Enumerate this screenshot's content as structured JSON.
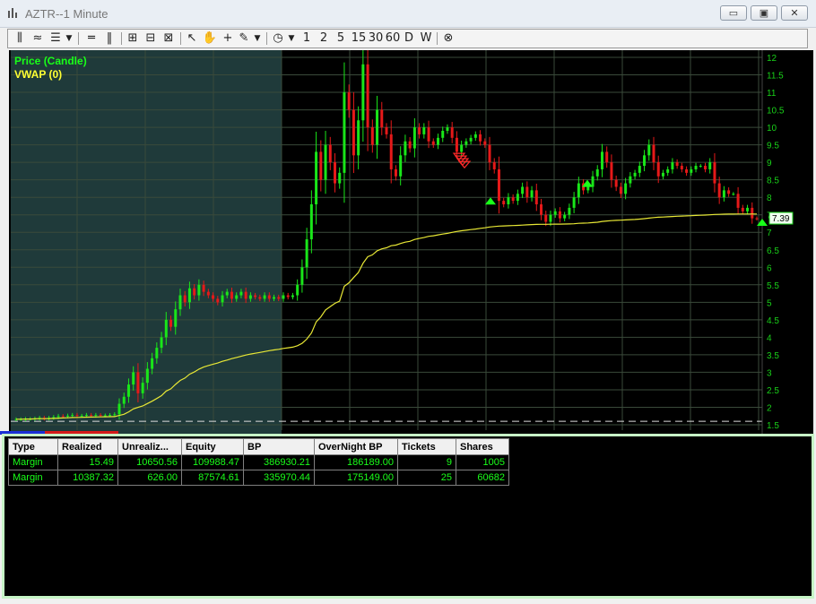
{
  "window": {
    "title": "AZTR--1 Minute",
    "controls": [
      "minimize",
      "maximize",
      "close"
    ]
  },
  "toolbar": {
    "icons": [
      "chart-type-icon",
      "drawing-style-icon",
      "indicator-list-icon",
      "dropdown-icon",
      "horizontal-line-icon",
      "vertical-line-icon",
      "zoom-in-icon",
      "zoom-out-icon",
      "fit-icon",
      "pointer-icon",
      "hand-icon",
      "crosshair-icon",
      "pencil-icon",
      "dropdown-icon",
      "clock-icon",
      "dropdown-icon"
    ],
    "intervals": [
      "1",
      "2",
      "5",
      "15",
      "30",
      "60",
      "D",
      "W"
    ],
    "close_icon": "circle-x-icon"
  },
  "chart": {
    "legend": [
      {
        "label": "Price (Candle)",
        "color": "#19ff19"
      },
      {
        "label": "VWAP (0)",
        "color": "#ffff33"
      }
    ],
    "price_labels": [
      "12",
      "11.5",
      "11",
      "10.5",
      "10",
      "9.5",
      "9",
      "8.5",
      "8",
      "7.5",
      "7",
      "6.5",
      "6",
      "5.5",
      "5",
      "4.5",
      "4",
      "3.5",
      "3",
      "2.5",
      "2",
      "1.5"
    ],
    "last_price": "7.39",
    "colors": {
      "up": "#19e619",
      "down": "#e61919",
      "vwap": "#e8e835",
      "premarket_bg": "#1f3a3a",
      "grid": "#3a4a3a"
    }
  },
  "chart_data": {
    "type": "candlestick",
    "symbol": "AZTR",
    "interval": "1 Minute",
    "y_range": [
      1.5,
      12
    ],
    "series": [
      {
        "name": "Price (Candle)",
        "close": [
          1.66,
          1.66,
          1.67,
          1.67,
          1.68,
          1.7,
          1.68,
          1.7,
          1.72,
          1.75,
          1.74,
          1.76,
          1.78,
          1.76,
          1.76,
          1.78,
          1.76,
          1.78,
          1.77,
          1.77,
          1.78,
          1.8,
          2.1,
          2.3,
          2.65,
          3.0,
          2.4,
          2.7,
          3.1,
          3.4,
          3.7,
          4.0,
          4.5,
          4.3,
          4.8,
          5.2,
          5.0,
          5.4,
          5.2,
          5.5,
          5.3,
          5.2,
          5.1,
          5.0,
          5.2,
          5.3,
          5.1,
          5.2,
          5.3,
          5.1,
          5.2,
          5.15,
          5.1,
          5.2,
          5.1,
          5.15,
          5.1,
          5.2,
          5.15,
          5.2,
          5.5,
          6.0,
          6.8,
          7.8,
          9.3,
          8.5,
          9.5,
          9.0,
          8.4,
          8.7,
          11.0,
          10.5,
          9.2,
          10.2,
          11.8,
          10.0,
          9.5,
          10.5,
          10.0,
          9.8,
          8.8,
          8.6,
          9.2,
          9.6,
          9.4,
          10.0,
          9.8,
          10.0,
          9.6,
          9.5,
          9.7,
          9.9,
          10.0,
          9.7,
          9.3,
          9.5,
          9.6,
          9.7,
          9.8,
          9.6,
          9.5,
          9.0,
          8.8,
          7.9,
          7.8,
          8.0,
          7.9,
          8.1,
          8.3,
          8.0,
          8.2,
          7.8,
          7.5,
          7.3,
          7.5,
          7.6,
          7.4,
          7.5,
          7.7,
          8.0,
          8.4,
          8.2,
          8.3,
          8.6,
          8.8,
          9.3,
          9.0,
          8.5,
          8.3,
          8.1,
          8.4,
          8.6,
          8.7,
          8.9,
          9.2,
          9.5,
          9.0,
          8.6,
          8.7,
          8.8,
          9.0,
          8.9,
          8.8,
          8.7,
          8.8,
          8.9,
          8.9,
          8.8,
          9.0,
          8.4,
          8.0,
          8.2,
          8.1,
          8.1,
          7.7,
          7.6,
          7.7,
          7.4,
          7.39
        ]
      },
      {
        "name": "VWAP (0)",
        "values": "cumulative"
      }
    ],
    "markers": [
      {
        "type": "sell",
        "label": "multiple sell arrows",
        "price": 9.0
      },
      {
        "type": "buy",
        "price": 8.0
      },
      {
        "type": "buy",
        "price": 8.5
      },
      {
        "type": "buy",
        "price": 7.39
      }
    ]
  },
  "account_table": {
    "headers": [
      "Type",
      "Realized",
      "Unrealiz...",
      "Equity",
      "BP",
      "OverNight BP",
      "Tickets",
      "Shares"
    ],
    "rows": [
      [
        "Margin",
        "15.49",
        "10650.56",
        "109988.47",
        "386930.21",
        "186189.00",
        "9",
        "1005"
      ],
      [
        "Margin",
        "10387.32",
        "626.00",
        "87574.61",
        "335970.44",
        "175149.00",
        "25",
        "60682"
      ]
    ]
  }
}
